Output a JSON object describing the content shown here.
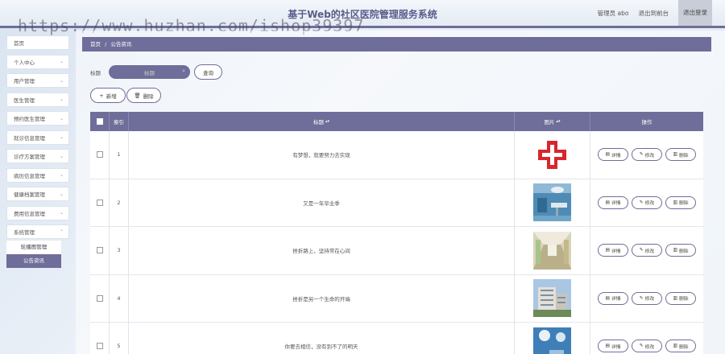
{
  "header": {
    "title": "基于Web的社区医院管理服务系统",
    "user": "管理员 abo",
    "back_label": "退出到前台",
    "logout_label": "退出登录"
  },
  "watermark": "https://www.huzhan.com/ishop39397",
  "sidebar": {
    "items": [
      {
        "label": "首页",
        "has_chevron": false
      },
      {
        "label": "个人中心",
        "has_chevron": true
      },
      {
        "label": "用户管理",
        "has_chevron": true
      },
      {
        "label": "医生管理",
        "has_chevron": true
      },
      {
        "label": "预约医生管理",
        "has_chevron": true
      },
      {
        "label": "就诊信息管理",
        "has_chevron": true
      },
      {
        "label": "诊疗方案管理",
        "has_chevron": true
      },
      {
        "label": "病历信息管理",
        "has_chevron": true
      },
      {
        "label": "健康档案管理",
        "has_chevron": true
      },
      {
        "label": "费用信息管理",
        "has_chevron": true
      },
      {
        "label": "系统管理",
        "has_chevron": true
      }
    ],
    "submenu": [
      {
        "label": "轮播图管理",
        "active": false
      },
      {
        "label": "公告资讯",
        "active": true
      }
    ]
  },
  "breadcrumb": {
    "home": "首页",
    "sep": "/",
    "current": "公告资讯"
  },
  "search": {
    "label": "标题",
    "placeholder": "标题",
    "query_label": "查询"
  },
  "actions": {
    "add_label": "新增",
    "delete_label": "删除"
  },
  "table": {
    "headers": {
      "index": "索引",
      "title": "标题",
      "picture": "图片",
      "ops": "操作"
    },
    "op_labels": {
      "detail": "详情",
      "edit": "修改",
      "delete": "删除"
    },
    "rows": [
      {
        "index": "1",
        "title": "有梦想，就要努力去实现"
      },
      {
        "index": "2",
        "title": "又是一年毕业季"
      },
      {
        "index": "3",
        "title": "挫折路上，坚持常在心间"
      },
      {
        "index": "4",
        "title": "挫折是另一个生命的开端"
      },
      {
        "index": "5",
        "title": "你要去相信，没有到不了的明天"
      }
    ]
  },
  "colors": {
    "accent": "#6f6d99",
    "red_cross": "#d8262d"
  }
}
